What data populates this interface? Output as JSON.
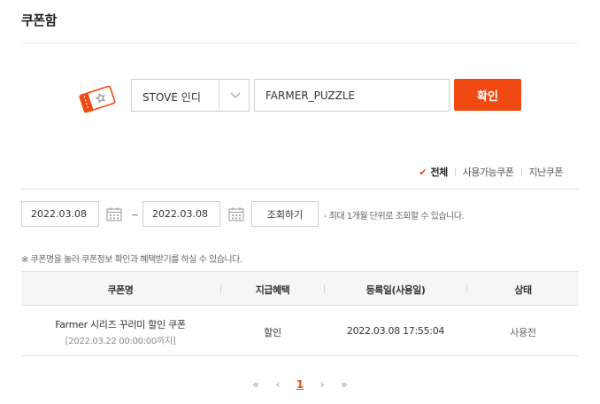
{
  "page": {
    "title": "쿠폰함"
  },
  "register": {
    "platform_value": "STOVE 인디",
    "coupon_code": "FARMER_PUZZLE",
    "confirm_label": "확인"
  },
  "filters": {
    "items": [
      {
        "label": "전체",
        "active": true
      },
      {
        "label": "사용가능쿠폰",
        "active": false
      },
      {
        "label": "지난쿠폰",
        "active": false
      }
    ]
  },
  "date_search": {
    "start_date": "2022.03.08",
    "separator": "~",
    "end_date": "2022.03.08",
    "search_label": "조회하기",
    "range_note": "- 최대 1개월 단위로 조회할 수 있습니다."
  },
  "info_note": "※ 쿠폰명을 눌러 쿠폰정보 확인과 혜택받기를 하실 수 있습니다.",
  "table": {
    "columns": [
      "쿠폰명",
      "지급혜택",
      "등록일(사용일)",
      "상태"
    ],
    "rows": [
      {
        "name": "Farmer 시리즈 꾸러미 할인 쿠폰",
        "expiry": "[2022.03.22 00:00:00까지]",
        "benefit": "할인",
        "registered": "2022.03.08 17:55:04",
        "status": "사용전"
      }
    ]
  },
  "pagination": {
    "first": "«",
    "prev": "‹",
    "current": "1",
    "next": "›",
    "last": "»"
  },
  "colors": {
    "accent": "#f04a12"
  }
}
